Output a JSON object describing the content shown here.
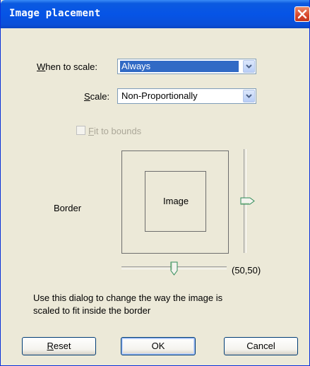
{
  "window": {
    "title": "Image placement"
  },
  "when_to_scale": {
    "accesskey": "W",
    "label_rest": "hen to scale:",
    "value": "Always"
  },
  "scale": {
    "accesskey": "S",
    "label_rest": "cale:",
    "value": "Non-Proportionally"
  },
  "fit_to_bounds": {
    "accesskey": "F",
    "label_rest": "it to bounds",
    "checked": false,
    "enabled": false
  },
  "preview": {
    "border_label": "Border",
    "image_label": "Image",
    "position_readout": "(50,50)"
  },
  "sliders": {
    "horizontal_value": 50,
    "vertical_value": 50
  },
  "help_text": {
    "line1": "Use this dialog to change the way  the image is",
    "line2": "scaled to fit inside the border"
  },
  "buttons": {
    "reset_accesskey": "R",
    "reset_rest": "eset",
    "ok": "OK",
    "cancel": "Cancel"
  },
  "colors": {
    "title_bar": "#0654E6",
    "dialog_bg": "#ECE9D8",
    "selection": "#316AC5",
    "close_button": "#D8462A"
  },
  "icons": {
    "close": "close-icon",
    "dropdown": "chevron-down-icon"
  }
}
